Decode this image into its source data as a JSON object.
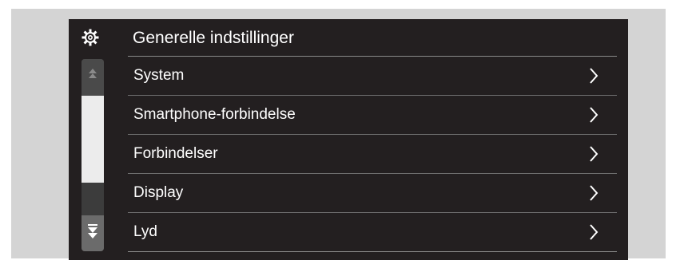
{
  "header": {
    "title": "Generelle indstillinger",
    "icon": "gear-icon"
  },
  "menu": {
    "items": [
      {
        "label": "System",
        "icon": "chevron-right-icon"
      },
      {
        "label": "Smartphone-forbindelse",
        "icon": "chevron-right-icon"
      },
      {
        "label": "Forbindelser",
        "icon": "chevron-right-icon"
      },
      {
        "label": "Display",
        "icon": "chevron-right-icon"
      },
      {
        "label": "Lyd",
        "icon": "chevron-right-icon"
      }
    ]
  },
  "scrollbar": {
    "up_icon": "scroll-up-icon",
    "down_icon": "scroll-down-icon"
  },
  "colors": {
    "screen_background": "#231f20",
    "frame_background": "#d4d4d4",
    "text": "#ffffff",
    "scroll_thumb": "#ececec",
    "divider": "#6f6f6f"
  }
}
